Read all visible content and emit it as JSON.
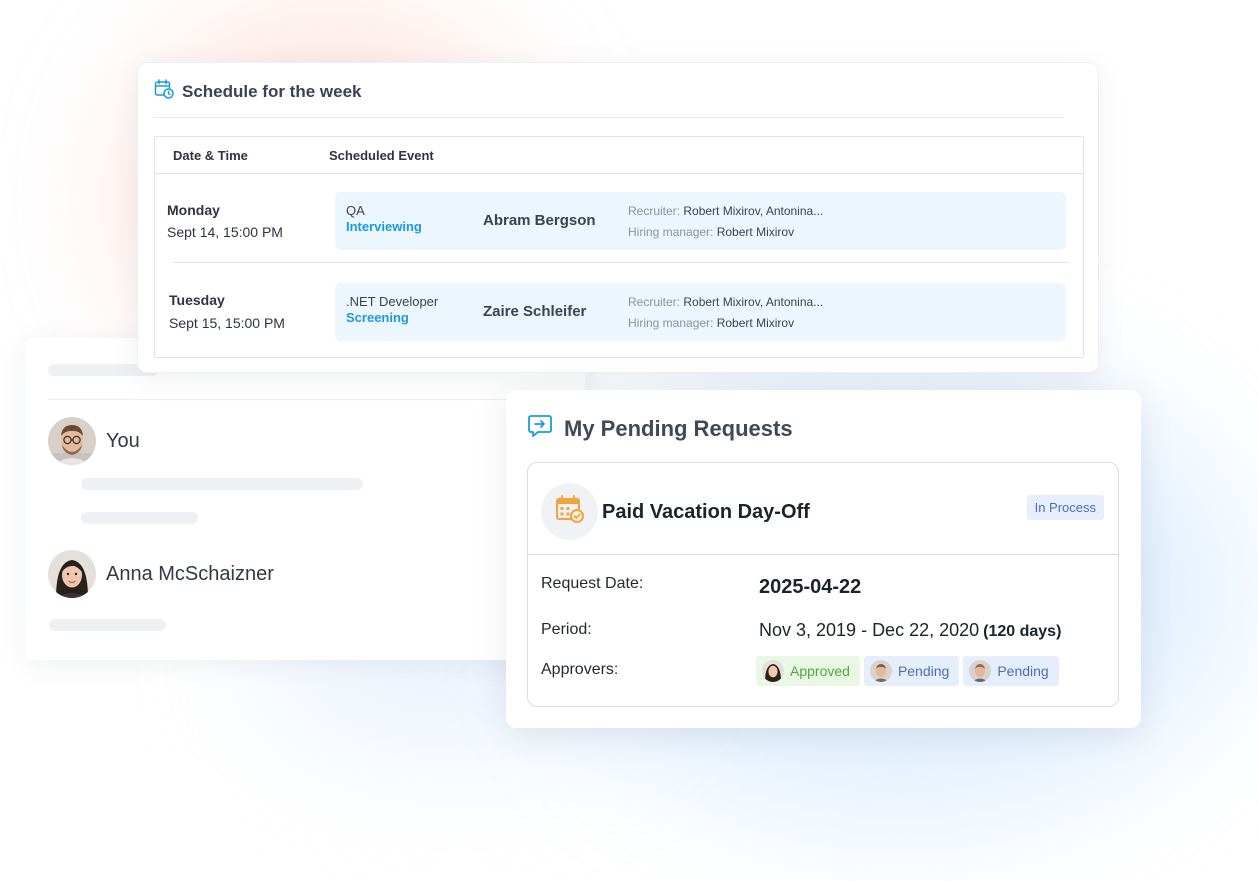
{
  "schedule": {
    "title": "Schedule for the week",
    "columns": {
      "date_time": "Date & Time",
      "scheduled_event": "Scheduled Event"
    },
    "rows": [
      {
        "day": "Monday",
        "date": "Sept 14, 15:00 PM",
        "role": "QA",
        "stage": "Interviewing",
        "candidate": "Abram Bergson",
        "recruiter_label": "Recruiter:",
        "recruiter_value": "Robert Mixirov, Antonina...",
        "hiring_manager_label": "Hiring manager:",
        "hiring_manager_value": "Robert Mixirov"
      },
      {
        "day": "Tuesday",
        "date": "Sept 15, 15:00 PM",
        "role": ".NET Developer",
        "stage": "Screening",
        "candidate": "Zaire Schleifer",
        "recruiter_label": "Recruiter:",
        "recruiter_value": "Robert Mixirov, Antonina...",
        "hiring_manager_label": "Hiring manager:",
        "hiring_manager_value": "Robert Mixirov"
      }
    ]
  },
  "chat": {
    "users": [
      {
        "name": "You"
      },
      {
        "name": "Anna McSchaizner"
      }
    ]
  },
  "pending": {
    "title": "My Pending Requests",
    "request": {
      "type": "Paid Vacation Day-Off",
      "status": "In Process",
      "request_date_label": "Request Date:",
      "request_date": "2025-04-22",
      "period_label": "Period:",
      "period": "Nov 3, 2019 - Dec 22, 2020",
      "period_days": "(120 days)",
      "approvers_label": "Approvers:",
      "approvers": [
        {
          "status": "Approved"
        },
        {
          "status": "Pending"
        },
        {
          "status": "Pending"
        }
      ]
    }
  },
  "colors": {
    "accent_blue": "#1a9be0",
    "event_bg": "#ecf6fe",
    "approved_green": "#4caa3a",
    "pending_blue": "#4a6fb3",
    "calendar_orange": "#f2a43c"
  },
  "icons": {
    "schedule": "calendar-clock-icon",
    "pending": "chat-arrow-icon",
    "request": "calendar-check-icon"
  }
}
